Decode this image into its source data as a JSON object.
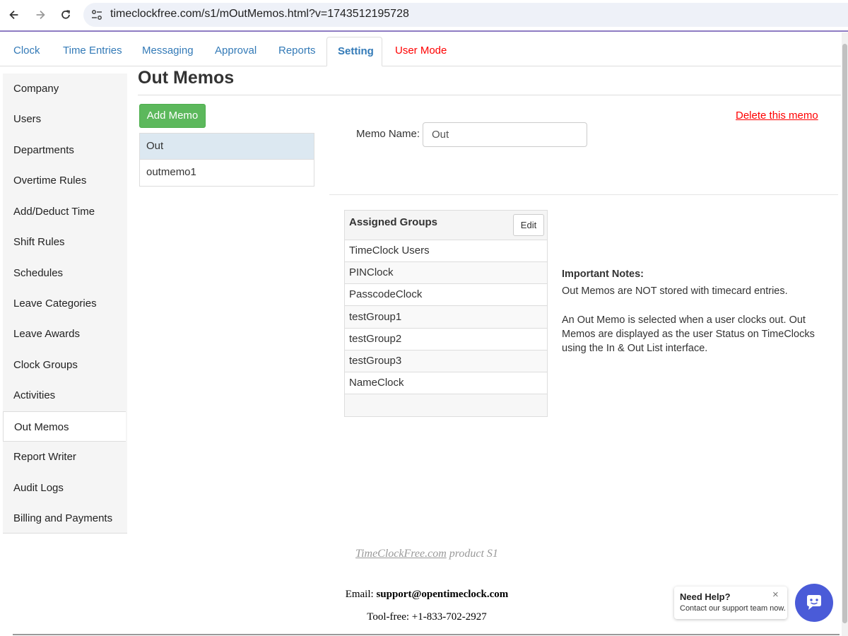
{
  "browser": {
    "url": "timeclockfree.com/s1/mOutMemos.html?v=1743512195728"
  },
  "tabs": [
    {
      "label": "Clock"
    },
    {
      "label": "Time Entries"
    },
    {
      "label": "Messaging"
    },
    {
      "label": "Approval"
    },
    {
      "label": "Reports"
    },
    {
      "label": "Setting"
    },
    {
      "label": "User Mode"
    }
  ],
  "sidebar": {
    "items": [
      {
        "label": "Company"
      },
      {
        "label": "Users"
      },
      {
        "label": "Departments"
      },
      {
        "label": "Overtime Rules"
      },
      {
        "label": "Add/Deduct Time"
      },
      {
        "label": "Shift Rules"
      },
      {
        "label": "Schedules"
      },
      {
        "label": "Leave Categories"
      },
      {
        "label": "Leave Awards"
      },
      {
        "label": "Clock Groups"
      },
      {
        "label": "Activities"
      },
      {
        "label": "Out Memos"
      },
      {
        "label": "Report Writer"
      },
      {
        "label": "Audit Logs"
      },
      {
        "label": "Billing and Payments"
      }
    ]
  },
  "main": {
    "title": "Out Memos",
    "add_button": "Add Memo",
    "memos": [
      {
        "label": "Out"
      },
      {
        "label": "outmemo1"
      }
    ],
    "memo_name_label": "Memo Name:",
    "memo_name_value": "Out",
    "delete_link": "Delete this memo",
    "groups": {
      "title": "Assigned Groups",
      "edit_button": "Edit",
      "rows": [
        "TimeClock Users",
        "PINClock",
        "PasscodeClock",
        "testGroup1",
        "testGroup2",
        "testGroup3",
        "NameClock"
      ]
    },
    "notes": {
      "title": "Important Notes:",
      "p1": "Out Memos are NOT stored with timecard entries.",
      "p2": "An Out Memo is selected when a user clocks out. Out Memos are displayed as the user Status on TimeClocks using the In & Out List interface."
    }
  },
  "footer": {
    "product_link": "TimeClockFree.com",
    "product_suffix": " product S1",
    "email_label": "Email: ",
    "email": "support@opentimeclock.com",
    "phone": "Tool-free: +1-833-702-2927"
  },
  "help": {
    "title": "Need Help?",
    "subtitle": "Contact our support team now.",
    "close": "×"
  },
  "colors": {
    "accent": "#337ab7",
    "add_button": "#5cb85c",
    "danger": "#ff0000",
    "help_bubble": "#4a5bd8"
  }
}
